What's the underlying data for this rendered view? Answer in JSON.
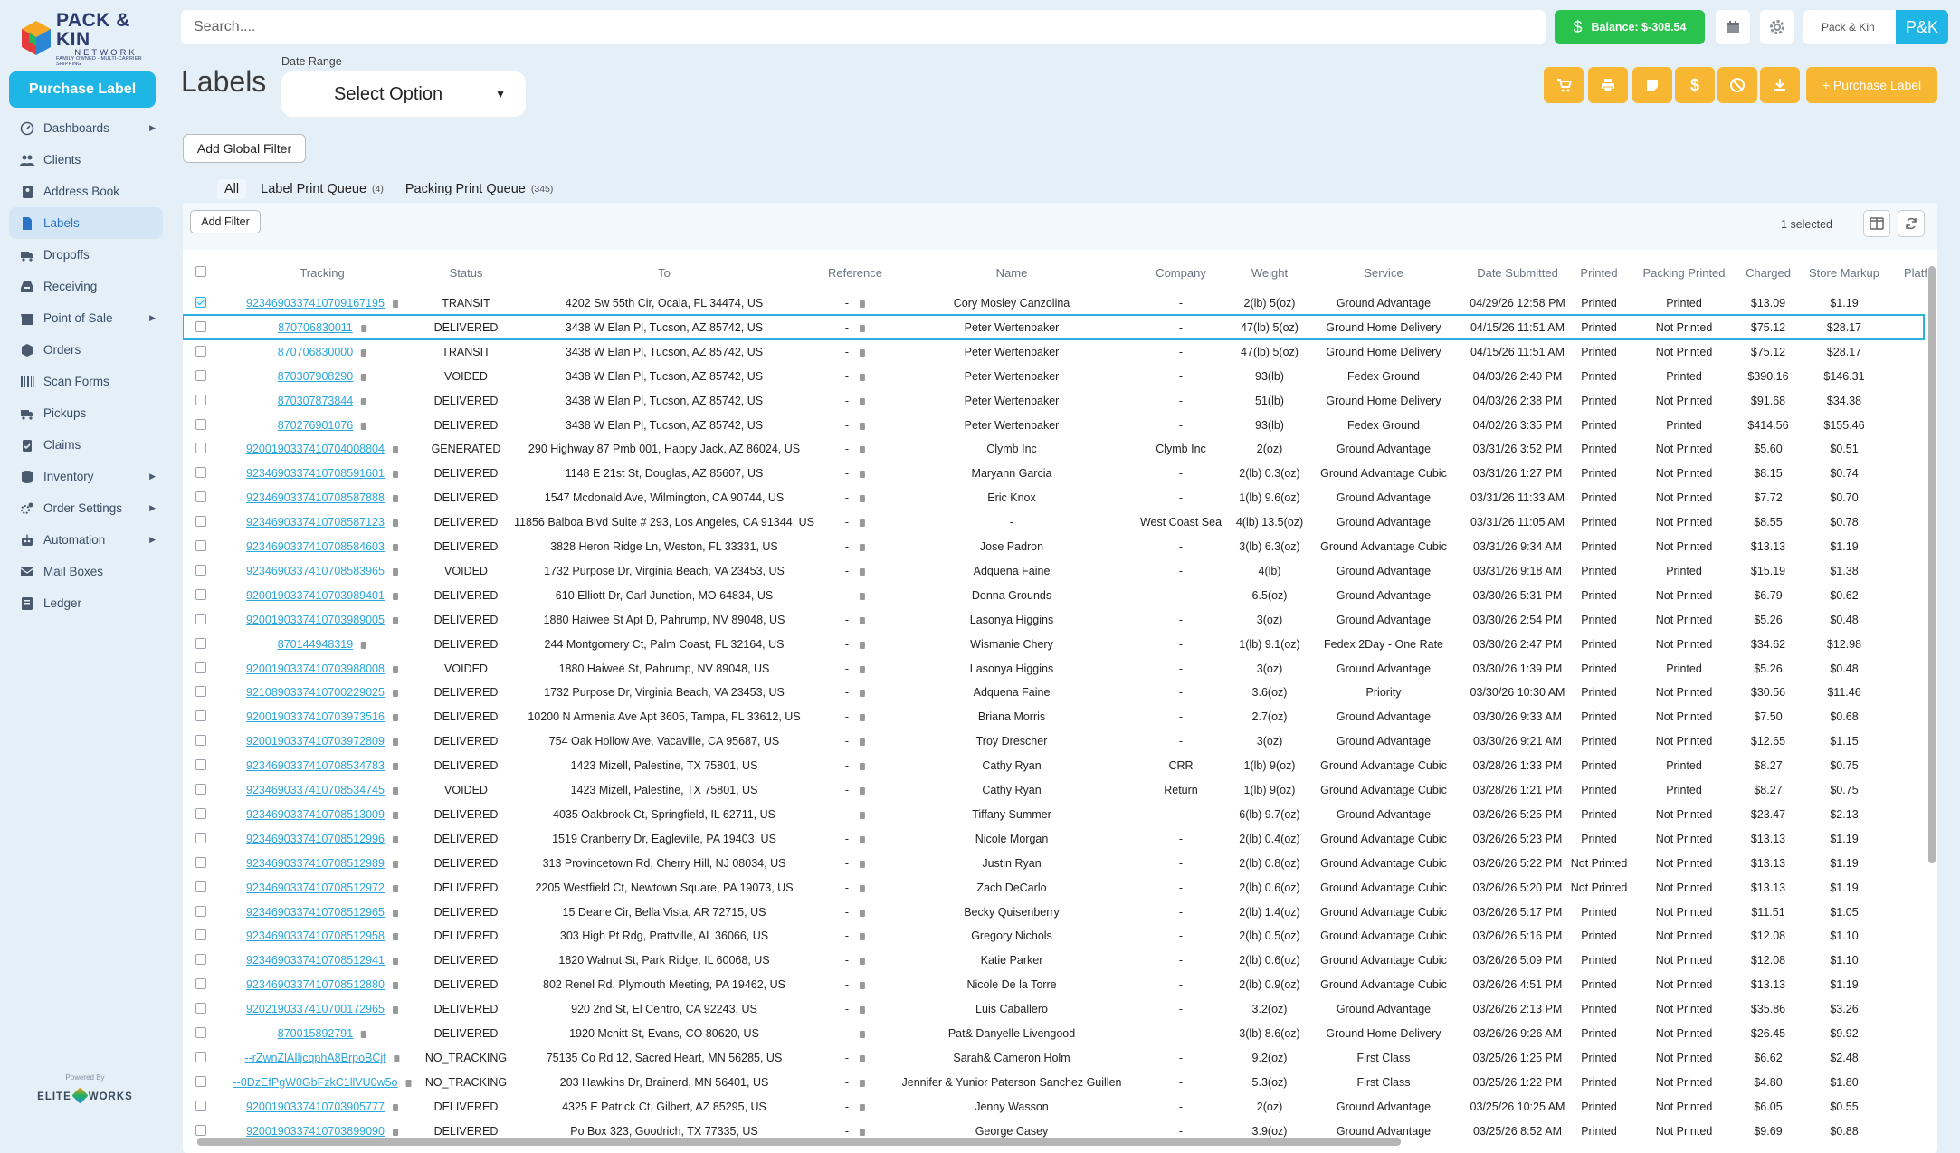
{
  "brand": {
    "name": "PACK & KIN",
    "sub": "NETWORK",
    "tag": "FAMILY OWNED - MULTI-CARRIER SHIPPING"
  },
  "sidebar": {
    "purchase_label": "Purchase Label",
    "items": [
      {
        "label": "Dashboards",
        "icon": "dashboard-icon",
        "chevron": true
      },
      {
        "label": "Clients",
        "icon": "users-icon",
        "chevron": false
      },
      {
        "label": "Address Book",
        "icon": "address-book-icon",
        "chevron": false
      },
      {
        "label": "Labels",
        "icon": "file-icon",
        "chevron": false,
        "active": true
      },
      {
        "label": "Dropoffs",
        "icon": "truck-icon",
        "chevron": false
      },
      {
        "label": "Receiving",
        "icon": "inbox-icon",
        "chevron": false
      },
      {
        "label": "Point of Sale",
        "icon": "store-icon",
        "chevron": true
      },
      {
        "label": "Orders",
        "icon": "box-icon",
        "chevron": false
      },
      {
        "label": "Scan Forms",
        "icon": "barcode-icon",
        "chevron": false
      },
      {
        "label": "Pickups",
        "icon": "truck-icon",
        "chevron": false
      },
      {
        "label": "Claims",
        "icon": "clipboard-icon",
        "chevron": false
      },
      {
        "label": "Inventory",
        "icon": "database-icon",
        "chevron": true
      },
      {
        "label": "Order Settings",
        "icon": "gears-icon",
        "chevron": true
      },
      {
        "label": "Automation",
        "icon": "robot-icon",
        "chevron": true
      },
      {
        "label": "Mail Boxes",
        "icon": "mail-icon",
        "chevron": false
      },
      {
        "label": "Ledger",
        "icon": "ledger-icon",
        "chevron": false
      }
    ],
    "powered_by": "Powered By",
    "elite_left": "ELITE",
    "elite_right": "WORKS"
  },
  "topbar": {
    "search_placeholder": "Search....",
    "balance": "Balance: $-308.54",
    "account_name": "Pack & Kin",
    "avatar": "P&K"
  },
  "header": {
    "title": "Labels",
    "date_range_label": "Date Range",
    "date_range_value": "Select Option",
    "purchase_label": "+ Purchase Label",
    "add_global_filter": "Add Global Filter"
  },
  "tabs": [
    {
      "label": "All",
      "count": ""
    },
    {
      "label": "Label Print Queue",
      "count": "(4)"
    },
    {
      "label": "Packing Print Queue",
      "count": "(345)"
    }
  ],
  "table": {
    "add_filter": "Add Filter",
    "selected_text": "1 selected",
    "columns": [
      "Tracking",
      "Status",
      "To",
      "Reference",
      "Name",
      "Company",
      "Weight",
      "Service",
      "Date Submitted",
      "Printed",
      "Packing Printed",
      "Charged",
      "Store Markup",
      "Platf"
    ],
    "rows": [
      [
        "9234690337410709167195",
        "TRANSIT",
        "4202 Sw 55th Cir, Ocala, FL 34474, US",
        "-",
        "Cory Mosley Canzolina",
        "-",
        "2(lb) 5(oz)",
        "Ground Advantage",
        "04/29/26 12:58 PM",
        "Printed",
        "Printed",
        "$13.09",
        "$1.19"
      ],
      [
        "870706830011",
        "DELIVERED",
        "3438 W Elan Pl, Tucson, AZ 85742, US",
        "-",
        "Peter Wertenbaker",
        "-",
        "47(lb) 5(oz)",
        "Ground Home Delivery",
        "04/15/26 11:51 AM",
        "Printed",
        "Not Printed",
        "$75.12",
        "$28.17"
      ],
      [
        "870706830000",
        "TRANSIT",
        "3438 W Elan Pl, Tucson, AZ 85742, US",
        "-",
        "Peter Wertenbaker",
        "-",
        "47(lb) 5(oz)",
        "Ground Home Delivery",
        "04/15/26 11:51 AM",
        "Printed",
        "Not Printed",
        "$75.12",
        "$28.17"
      ],
      [
        "870307908290",
        "VOIDED",
        "3438 W Elan Pl, Tucson, AZ 85742, US",
        "-",
        "Peter Wertenbaker",
        "-",
        "93(lb)",
        "Fedex Ground",
        "04/03/26 2:40 PM",
        "Printed",
        "Printed",
        "$390.16",
        "$146.31"
      ],
      [
        "870307873844",
        "DELIVERED",
        "3438 W Elan Pl, Tucson, AZ 85742, US",
        "-",
        "Peter Wertenbaker",
        "-",
        "51(lb)",
        "Ground Home Delivery",
        "04/03/26 2:38 PM",
        "Printed",
        "Not Printed",
        "$91.68",
        "$34.38"
      ],
      [
        "870276901076",
        "DELIVERED",
        "3438 W Elan Pl, Tucson, AZ 85742, US",
        "-",
        "Peter Wertenbaker",
        "-",
        "93(lb)",
        "Fedex Ground",
        "04/02/26 3:35 PM",
        "Printed",
        "Printed",
        "$414.56",
        "$155.46"
      ],
      [
        "9200190337410704008804",
        "GENERATED",
        "290 Highway 87 Pmb 001, Happy Jack, AZ 86024, US",
        "-",
        "Clymb Inc",
        "Clymb Inc",
        "2(oz)",
        "Ground Advantage",
        "03/31/26 3:52 PM",
        "Printed",
        "Not Printed",
        "$5.60",
        "$0.51"
      ],
      [
        "9234690337410708591601",
        "DELIVERED",
        "1148 E 21st St, Douglas, AZ 85607, US",
        "-",
        "Maryann Garcia",
        "-",
        "2(lb) 0.3(oz)",
        "Ground Advantage Cubic",
        "03/31/26 1:27 PM",
        "Printed",
        "Not Printed",
        "$8.15",
        "$0.74"
      ],
      [
        "9234690337410708587888",
        "DELIVERED",
        "1547 Mcdonald Ave, Wilmington, CA 90744, US",
        "-",
        "Eric Knox",
        "-",
        "1(lb) 9.6(oz)",
        "Ground Advantage",
        "03/31/26 11:33 AM",
        "Printed",
        "Not Printed",
        "$7.72",
        "$0.70"
      ],
      [
        "9234690337410708587123",
        "DELIVERED",
        "11856 Balboa Blvd Suite # 293, Los Angeles, CA 91344, US",
        "-",
        "-",
        "West Coast Sea",
        "4(lb) 13.5(oz)",
        "Ground Advantage",
        "03/31/26 11:05 AM",
        "Printed",
        "Not Printed",
        "$8.55",
        "$0.78"
      ],
      [
        "9234690337410708584603",
        "DELIVERED",
        "3828 Heron Ridge Ln, Weston, FL 33331, US",
        "-",
        "Jose Padron",
        "-",
        "3(lb) 6.3(oz)",
        "Ground Advantage Cubic",
        "03/31/26 9:34 AM",
        "Printed",
        "Not Printed",
        "$13.13",
        "$1.19"
      ],
      [
        "9234690337410708583965",
        "VOIDED",
        "1732 Purpose Dr, Virginia Beach, VA 23453, US",
        "-",
        "Adquena Faine",
        "-",
        "4(lb)",
        "Ground Advantage",
        "03/31/26 9:18 AM",
        "Printed",
        "Printed",
        "$15.19",
        "$1.38"
      ],
      [
        "9200190337410703989401",
        "DELIVERED",
        "610 Elliott Dr, Carl Junction, MO 64834, US",
        "-",
        "Donna Grounds",
        "-",
        "6.5(oz)",
        "Ground Advantage",
        "03/30/26 5:31 PM",
        "Printed",
        "Not Printed",
        "$6.79",
        "$0.62"
      ],
      [
        "9200190337410703989005",
        "DELIVERED",
        "1880 Haiwee St Apt D, Pahrump, NV 89048, US",
        "-",
        "Lasonya Higgins",
        "-",
        "3(oz)",
        "Ground Advantage",
        "03/30/26 2:54 PM",
        "Printed",
        "Not Printed",
        "$5.26",
        "$0.48"
      ],
      [
        "870144948319",
        "DELIVERED",
        "244 Montgomery Ct, Palm Coast, FL 32164, US",
        "-",
        "Wismanie Chery",
        "-",
        "1(lb) 9.1(oz)",
        "Fedex 2Day - One Rate",
        "03/30/26 2:47 PM",
        "Printed",
        "Not Printed",
        "$34.62",
        "$12.98"
      ],
      [
        "9200190337410703988008",
        "VOIDED",
        "1880 Haiwee St, Pahrump, NV 89048, US",
        "-",
        "Lasonya Higgins",
        "-",
        "3(oz)",
        "Ground Advantage",
        "03/30/26 1:39 PM",
        "Printed",
        "Printed",
        "$5.26",
        "$0.48"
      ],
      [
        "9210890337410700229025",
        "DELIVERED",
        "1732 Purpose Dr, Virginia Beach, VA 23453, US",
        "-",
        "Adquena Faine",
        "-",
        "3.6(oz)",
        "Priority",
        "03/30/26 10:30 AM",
        "Printed",
        "Not Printed",
        "$30.56",
        "$11.46"
      ],
      [
        "9200190337410703973516",
        "DELIVERED",
        "10200 N Armenia Ave Apt 3605, Tampa, FL 33612, US",
        "-",
        "Briana Morris",
        "-",
        "2.7(oz)",
        "Ground Advantage",
        "03/30/26 9:33 AM",
        "Printed",
        "Not Printed",
        "$7.50",
        "$0.68"
      ],
      [
        "9200190337410703972809",
        "DELIVERED",
        "754 Oak Hollow Ave, Vacaville, CA 95687, US",
        "-",
        "Troy Drescher",
        "-",
        "3(oz)",
        "Ground Advantage",
        "03/30/26 9:21 AM",
        "Printed",
        "Not Printed",
        "$12.65",
        "$1.15"
      ],
      [
        "9234690337410708534783",
        "DELIVERED",
        "1423 Mizell, Palestine, TX 75801, US",
        "-",
        "Cathy Ryan",
        "CRR",
        "1(lb) 9(oz)",
        "Ground Advantage Cubic",
        "03/28/26 1:33 PM",
        "Printed",
        "Printed",
        "$8.27",
        "$0.75"
      ],
      [
        "9234690337410708534745",
        "VOIDED",
        "1423 Mizell, Palestine, TX 75801, US",
        "-",
        "Cathy Ryan",
        "Return",
        "1(lb) 9(oz)",
        "Ground Advantage Cubic",
        "03/28/26 1:21 PM",
        "Printed",
        "Printed",
        "$8.27",
        "$0.75"
      ],
      [
        "9234690337410708513009",
        "DELIVERED",
        "4035 Oakbrook Ct, Springfield, IL 62711, US",
        "-",
        "Tiffany Summer",
        "-",
        "6(lb) 9.7(oz)",
        "Ground Advantage",
        "03/26/26 5:25 PM",
        "Printed",
        "Not Printed",
        "$23.47",
        "$2.13"
      ],
      [
        "9234690337410708512996",
        "DELIVERED",
        "1519 Cranberry Dr, Eagleville, PA 19403, US",
        "-",
        "Nicole Morgan",
        "-",
        "2(lb) 0.4(oz)",
        "Ground Advantage Cubic",
        "03/26/26 5:23 PM",
        "Printed",
        "Not Printed",
        "$13.13",
        "$1.19"
      ],
      [
        "9234690337410708512989",
        "DELIVERED",
        "313 Provincetown Rd, Cherry Hill, NJ 08034, US",
        "-",
        "Justin Ryan",
        "-",
        "2(lb) 0.8(oz)",
        "Ground Advantage Cubic",
        "03/26/26 5:22 PM",
        "Not Printed",
        "Not Printed",
        "$13.13",
        "$1.19"
      ],
      [
        "9234690337410708512972",
        "DELIVERED",
        "2205 Westfield Ct, Newtown Square, PA 19073, US",
        "-",
        "Zach DeCarlo",
        "-",
        "2(lb) 0.6(oz)",
        "Ground Advantage Cubic",
        "03/26/26 5:20 PM",
        "Not Printed",
        "Not Printed",
        "$13.13",
        "$1.19"
      ],
      [
        "9234690337410708512965",
        "DELIVERED",
        "15 Deane Cir, Bella Vista, AR 72715, US",
        "-",
        "Becky Quisenberry",
        "-",
        "2(lb) 1.4(oz)",
        "Ground Advantage Cubic",
        "03/26/26 5:17 PM",
        "Printed",
        "Not Printed",
        "$11.51",
        "$1.05"
      ],
      [
        "9234690337410708512958",
        "DELIVERED",
        "303 High Pt Rdg, Prattville, AL 36066, US",
        "-",
        "Gregory Nichols",
        "-",
        "2(lb) 0.5(oz)",
        "Ground Advantage Cubic",
        "03/26/26 5:16 PM",
        "Printed",
        "Not Printed",
        "$12.08",
        "$1.10"
      ],
      [
        "9234690337410708512941",
        "DELIVERED",
        "1820 Walnut St, Park Ridge, IL 60068, US",
        "-",
        "Katie Parker",
        "-",
        "2(lb) 0.6(oz)",
        "Ground Advantage Cubic",
        "03/26/26 5:09 PM",
        "Printed",
        "Not Printed",
        "$12.08",
        "$1.10"
      ],
      [
        "9234690337410708512880",
        "DELIVERED",
        "802 Renel Rd, Plymouth Meeting, PA 19462, US",
        "-",
        "Nicole De la Torre",
        "-",
        "2(lb) 0.9(oz)",
        "Ground Advantage Cubic",
        "03/26/26 4:51 PM",
        "Printed",
        "Not Printed",
        "$13.13",
        "$1.19"
      ],
      [
        "9202190337410700172965",
        "DELIVERED",
        "920 2nd St, El Centro, CA 92243, US",
        "-",
        "Luis Caballero",
        "-",
        "3.2(oz)",
        "Ground Advantage",
        "03/26/26 2:13 PM",
        "Printed",
        "Not Printed",
        "$35.86",
        "$3.26"
      ],
      [
        "870015892791",
        "DELIVERED",
        "1920 Mcnitt St, Evans, CO 80620, US",
        "-",
        "Pat& Danyelle Livengood",
        "-",
        "3(lb) 8.6(oz)",
        "Ground Home Delivery",
        "03/26/26 9:26 AM",
        "Printed",
        "Not Printed",
        "$26.45",
        "$9.92"
      ],
      [
        "--rZwnZlAIljcqphA8BrpoBCjf",
        "NO_TRACKING",
        "75135 Co Rd 12, Sacred Heart, MN 56285, US",
        "-",
        "Sarah& Cameron Holm",
        "-",
        "9.2(oz)",
        "First Class",
        "03/25/26 1:25 PM",
        "Printed",
        "Not Printed",
        "$6.62",
        "$2.48"
      ],
      [
        "--0DzEfPgW0GbFzkC1llVU0w5o",
        "NO_TRACKING",
        "203 Hawkins Dr, Brainerd, MN 56401, US",
        "-",
        "Jennifer & Yunior Paterson Sanchez Guillen",
        "-",
        "5.3(oz)",
        "First Class",
        "03/25/26 1:22 PM",
        "Printed",
        "Not Printed",
        "$4.80",
        "$1.80"
      ],
      [
        "9200190337410703905777",
        "DELIVERED",
        "4325 E Patrick Ct, Gilbert, AZ 85295, US",
        "-",
        "Jenny Wasson",
        "-",
        "2(oz)",
        "Ground Advantage",
        "03/25/26 10:25 AM",
        "Printed",
        "Not Printed",
        "$6.05",
        "$0.55"
      ],
      [
        "9200190337410703899090",
        "DELIVERED",
        "Po Box 323, Goodrich, TX 77335, US",
        "-",
        "George Casey",
        "-",
        "3.9(oz)",
        "Ground Advantage",
        "03/25/26 8:52 AM",
        "Printed",
        "Not Printed",
        "$9.69",
        "$0.88"
      ]
    ]
  }
}
